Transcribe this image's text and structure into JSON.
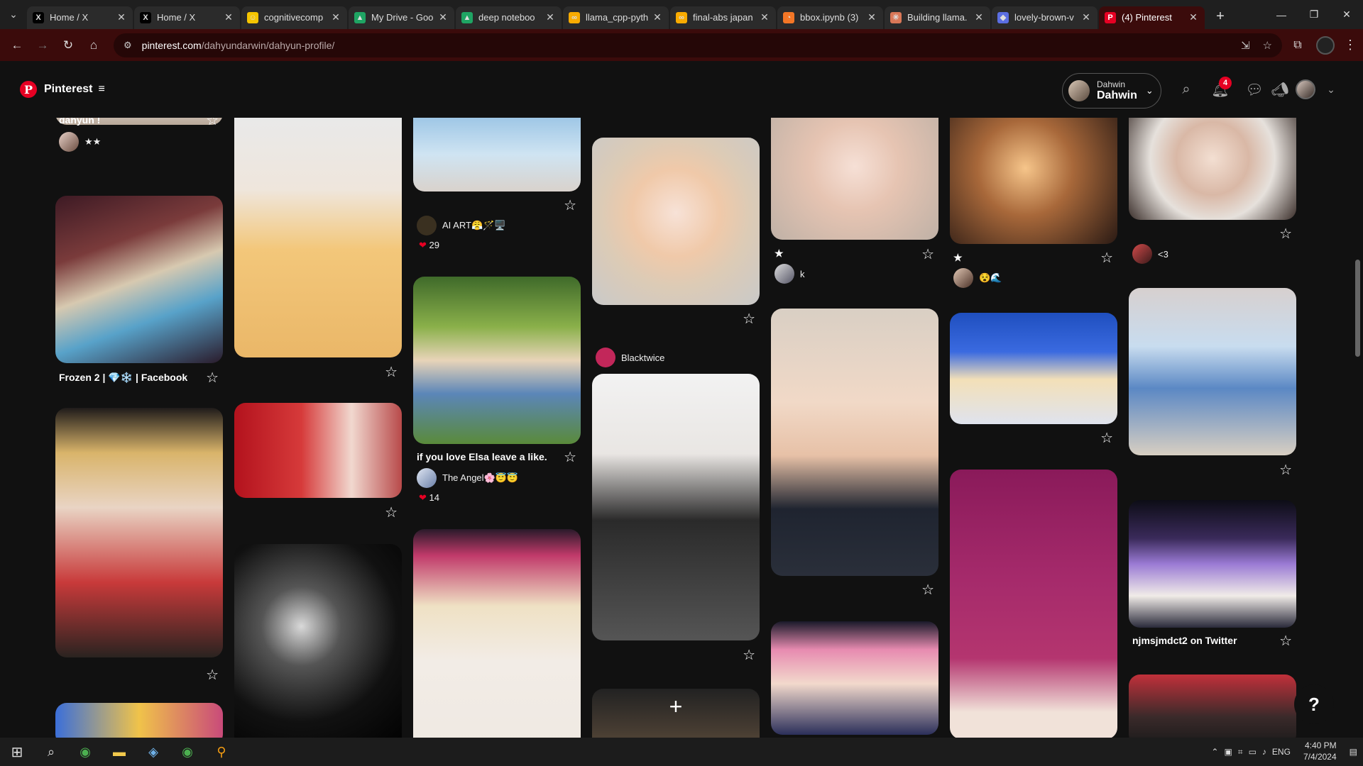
{
  "browser": {
    "tabs": [
      {
        "title": "Home / X",
        "favicon": "X",
        "favcolor": "#000000"
      },
      {
        "title": "Home / X",
        "favicon": "X",
        "favcolor": "#000000"
      },
      {
        "title": "cognitivecomp",
        "favicon": "☺",
        "favcolor": "#f5c400"
      },
      {
        "title": "My Drive - Goo",
        "favicon": "▲",
        "favcolor": "#1fa463"
      },
      {
        "title": "deep noteboo",
        "favicon": "▲",
        "favcolor": "#1fa463"
      },
      {
        "title": "llama_cpp-pyth",
        "favicon": "∞",
        "favcolor": "#f9ab00"
      },
      {
        "title": "final-abs japan",
        "favicon": "∞",
        "favcolor": "#f9ab00"
      },
      {
        "title": "bbox.ipynb (3)",
        "favicon": "◔",
        "favcolor": "#f37626"
      },
      {
        "title": "Building llama.",
        "favicon": "✳",
        "favcolor": "#d97757"
      },
      {
        "title": "lovely-brown-v",
        "favicon": "◆",
        "favcolor": "#5b6ee1"
      },
      {
        "title": "(4) Pinterest",
        "favicon": "P",
        "favcolor": "#e60023"
      }
    ],
    "url_host": "pinterest.com",
    "url_path": "/dahyundarwin/dahyun-profile/"
  },
  "header": {
    "brand": "Pinterest",
    "account_small": "Dahwin",
    "account_big": "Dahwin",
    "notification_count": "4"
  },
  "pins": {
    "c1_0": {
      "title": "dahyun !",
      "sub": "★★"
    },
    "c1_1": {
      "title": "Frozen 2 | 💎❄️ | Facebook"
    },
    "c3_0": {
      "author": "AI ART😤🪄🖥️",
      "likes": "29"
    },
    "c3_1": {
      "title": "if you love Elsa leave a like.",
      "author": "The Angel🌸😇😇",
      "likes": "14"
    },
    "c4_0": {
      "author": "Blacktwice"
    },
    "c5_0": {
      "title": "★",
      "author": "k"
    },
    "c6_0": {
      "title": "★",
      "author": "😵🌊"
    },
    "c7_0": {
      "author": "<3"
    },
    "c7_2": {
      "title": "njmsjmdct2 on Twitter"
    }
  },
  "taskbar": {
    "lang": "ENG",
    "time": "4:40 PM",
    "date": "7/4/2024"
  }
}
